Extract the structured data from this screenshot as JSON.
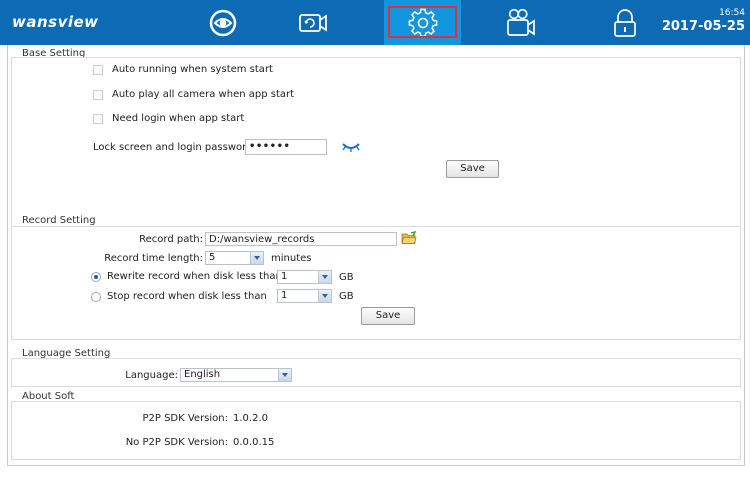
{
  "header": {
    "logo": "wansview",
    "nav": [
      {
        "name": "preview",
        "icon": "eye-icon"
      },
      {
        "name": "playback",
        "icon": "video-playback-icon"
      },
      {
        "name": "settings",
        "icon": "gear-icon"
      },
      {
        "name": "record",
        "icon": "record-camera-icon"
      },
      {
        "name": "lock",
        "icon": "lock-icon"
      }
    ],
    "time": "16:54",
    "date": "2017-05-25"
  },
  "base": {
    "title": "Base Setting",
    "auto_running": "Auto running when system start",
    "auto_play": "Auto play all camera when app start",
    "need_login": "Need login when app start",
    "password_label": "Lock screen and login password:",
    "password_value": "••••••",
    "save": "Save"
  },
  "record": {
    "title": "Record Setting",
    "path_label": "Record path:",
    "path_value": "D:/wansview_records",
    "time_label": "Record time length:",
    "time_value": "5",
    "time_unit": "minutes",
    "rewrite_label": "Rewrite record when disk less than",
    "rewrite_value": "1",
    "rewrite_unit": "GB",
    "stop_label": "Stop record when disk less than",
    "stop_value": "1",
    "stop_unit": "GB",
    "save": "Save"
  },
  "language": {
    "title": "Language Setting",
    "label": "Language:",
    "value": "English"
  },
  "about": {
    "title": "About Soft",
    "p2p_label": "P2P SDK Version:",
    "p2p_value": "1.0.2.0",
    "nop2p_label": "No P2P SDK Version:",
    "nop2p_value": "0.0.0.15"
  },
  "colors": {
    "topbar": "#0d6bb5",
    "active_tab": "#1296dd",
    "selection_outline": "#e0303a"
  }
}
